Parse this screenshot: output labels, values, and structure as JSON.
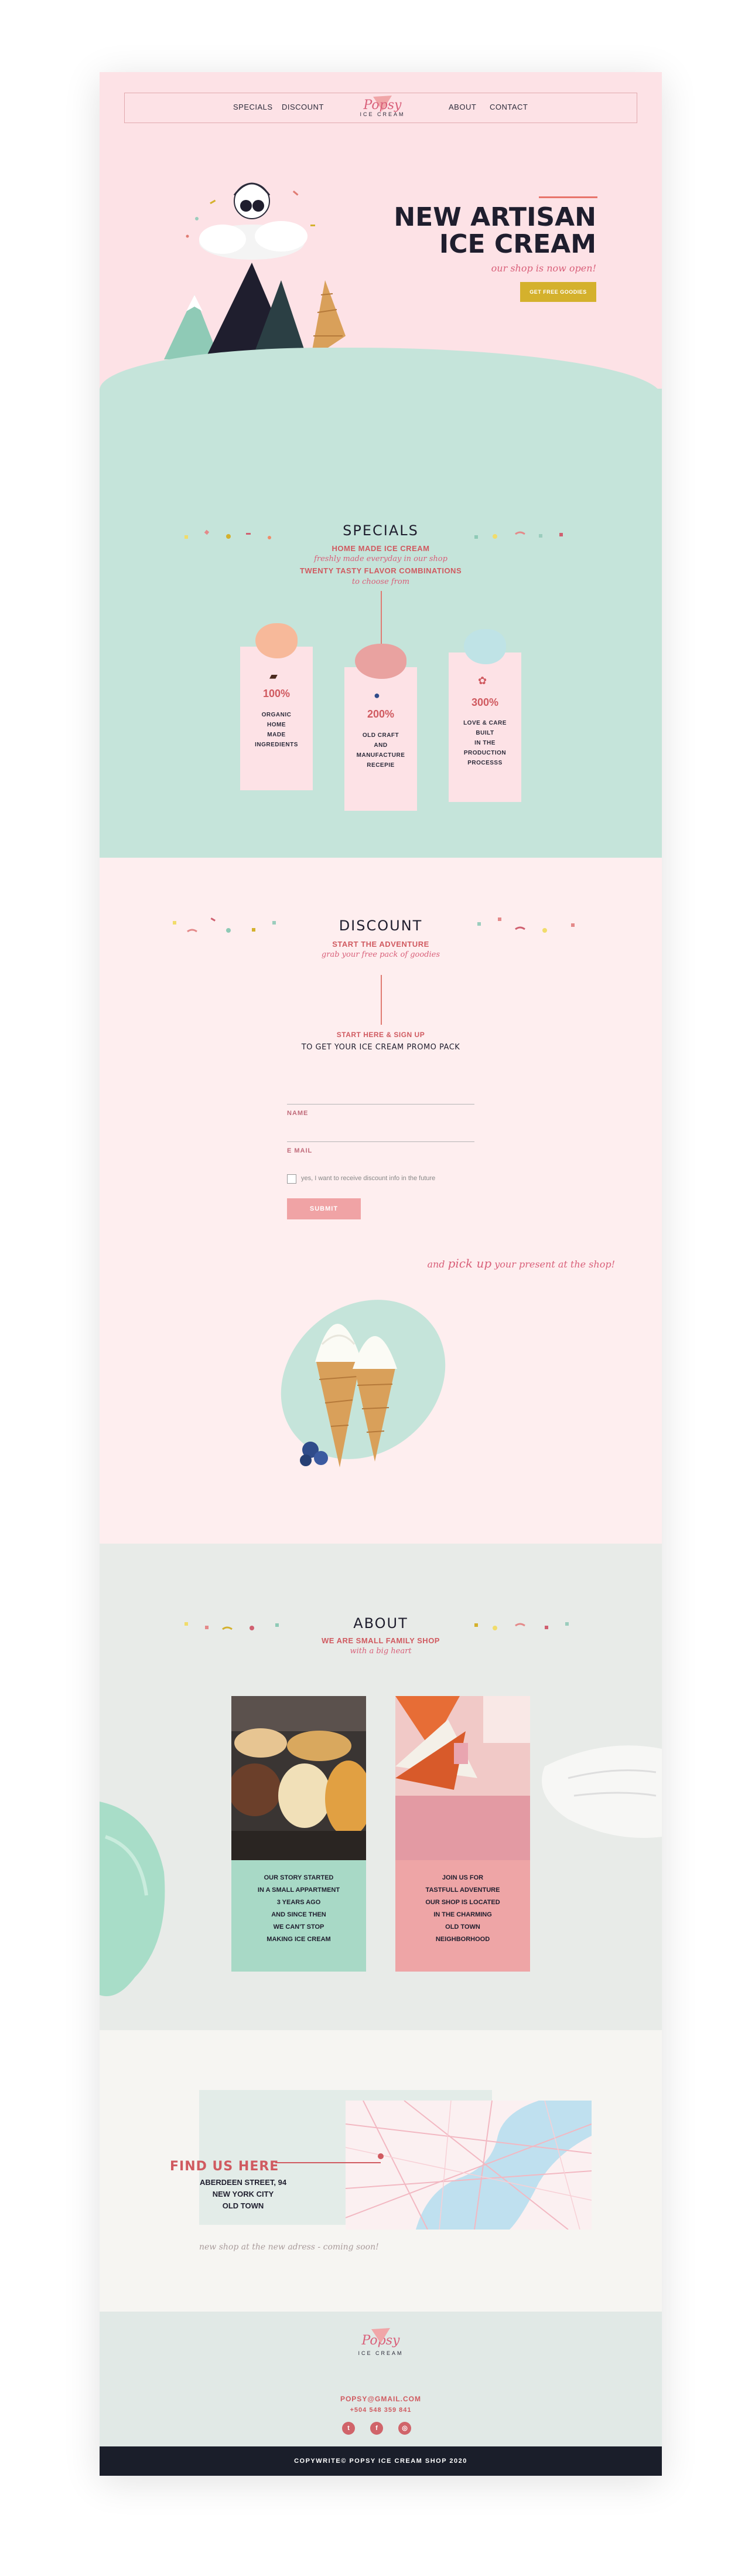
{
  "nav": {
    "specials": "SPECIALS",
    "discount": "DISCOUNT",
    "about": "ABOUT",
    "contact": "CONTACT"
  },
  "brand": {
    "name": "Popsy",
    "sub": "ICE CREAM"
  },
  "hero": {
    "title_line1": "NEW ARTISAN",
    "title_line2": "ICE CREAM",
    "tagline": "our shop is now open!",
    "button": "GET FREE GOODIES"
  },
  "specials": {
    "title": "SPECIALS",
    "subtitle_red": "HOME MADE ICE CREAM",
    "subtitle_script": "freshly made everyday in our shop",
    "subtitle2_red": "TWENTY TASTY FLAVOR COMBINATIONS",
    "subtitle2_script": "to choose from",
    "cards": [
      {
        "pct": "100%",
        "lines": [
          "ORGANIC",
          "HOME",
          "MADE",
          "INGREDIENTS"
        ]
      },
      {
        "pct": "200%",
        "lines": [
          "OLD CRAFT",
          "AND",
          "MANUFACTURE",
          "RECEPIE"
        ]
      },
      {
        "pct": "300%",
        "lines": [
          "LOVE & CARE",
          "BUILT",
          "IN THE",
          "PRODUCTION",
          "PROCESSS"
        ]
      }
    ]
  },
  "discount": {
    "title": "DISCOUNT",
    "subtitle_red": "START THE ADVENTURE",
    "subtitle_script": "grab your free pack of goodies",
    "signup_red": "START HERE & SIGN UP",
    "signup_sub": "TO GET YOUR ICE CREAM PROMO PACK",
    "name_label": "NAME",
    "email_label": "E MAIL",
    "checkbox_label": "yes, I want to receive discount info in the future",
    "submit": "SUBMIT",
    "pickup_pre": "and ",
    "pickup_em": "pick up",
    "pickup_post": " your present at the shop!"
  },
  "about": {
    "title": "ABOUT",
    "subtitle_red": "WE ARE SMALL FAMILY SHOP",
    "subtitle_script": "with a big heart",
    "card1_lines": [
      "OUR STORY STARTED",
      "IN A SMALL APPARTMENT",
      "3 YEARS AGO",
      "AND SINCE THEN",
      "WE CAN'T STOP",
      "MAKING ICE CREAM"
    ],
    "card2_lines": [
      "JOIN US FOR",
      "TASTFULL ADVENTURE",
      "OUR SHOP IS LOCATED",
      "IN THE CHARMING",
      "OLD TOWN",
      "NEIGHBORHOOD"
    ]
  },
  "find": {
    "title": "FIND US HERE",
    "address": [
      "ABERDEEN STREET, 94",
      "NEW YORK CITY",
      "OLD TOWN"
    ],
    "note": "new shop at the new adress - coming soon!"
  },
  "footer": {
    "email": "POPSY@GMAIL.COM",
    "phone": "+504 548 359 841",
    "copyright": "COPYWRITE© POPSY ICE CREAM SHOP 2020"
  },
  "colors": {
    "hero_pink": "#fde2e6",
    "mint": "#c5e4da",
    "accent_red": "#d05a60",
    "mustard": "#d4b12d",
    "footer_dark": "#1a1e2a"
  },
  "icons": [
    "twitter-icon",
    "facebook-icon",
    "instagram-icon",
    "chocolate-icon",
    "blueberry-icon",
    "leaf-icon"
  ]
}
